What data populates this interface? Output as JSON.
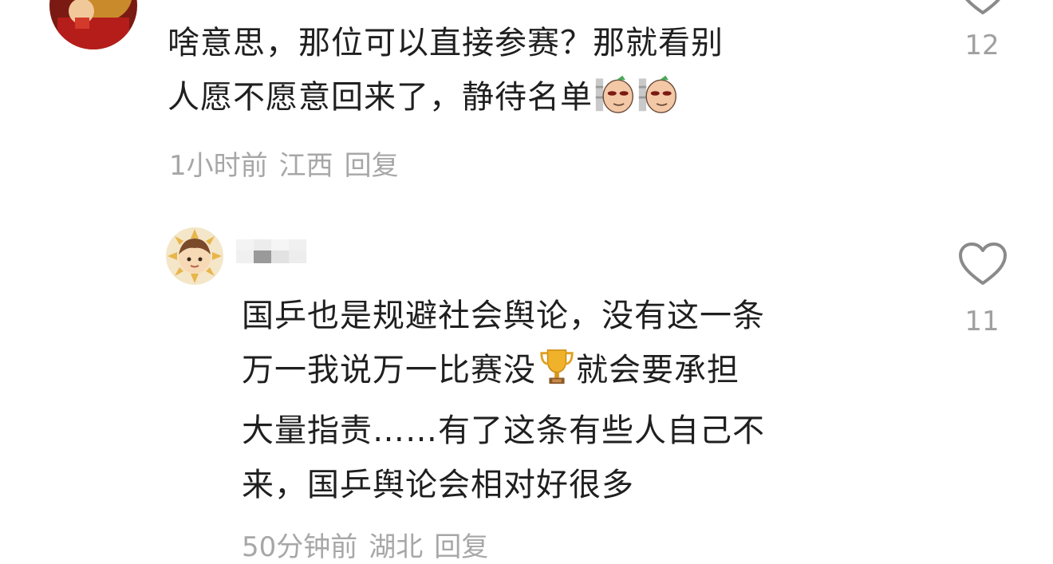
{
  "comments": [
    {
      "lines": [
        "啥意思，那位可以直接参赛？那就看别",
        "人愿不愿意回来了，静待名单"
      ],
      "emojis": [
        "sly-egg-emoji",
        "sly-egg-emoji"
      ],
      "time": "1小时前",
      "location": "江西",
      "reply_label": "回复",
      "likes": "12"
    },
    {
      "lines": [
        "国乒也是规避社会舆论，没有这一条",
        "万一我说万一比赛没",
        "就会要承担",
        "大量指责……有了这条有些人自己不",
        "来，国乒舆论会相对好很多"
      ],
      "emojis": [
        "trophy-emoji"
      ],
      "time": "50分钟前",
      "location": "湖北",
      "reply_label": "回复",
      "likes": "11"
    }
  ],
  "icons": {
    "like": "heart-outline-icon"
  },
  "colors": {
    "text": "#1f1f1f",
    "meta": "#a7a7a7",
    "like_count": "#a0a0a0",
    "heart_stroke": "#8a8a8a"
  }
}
